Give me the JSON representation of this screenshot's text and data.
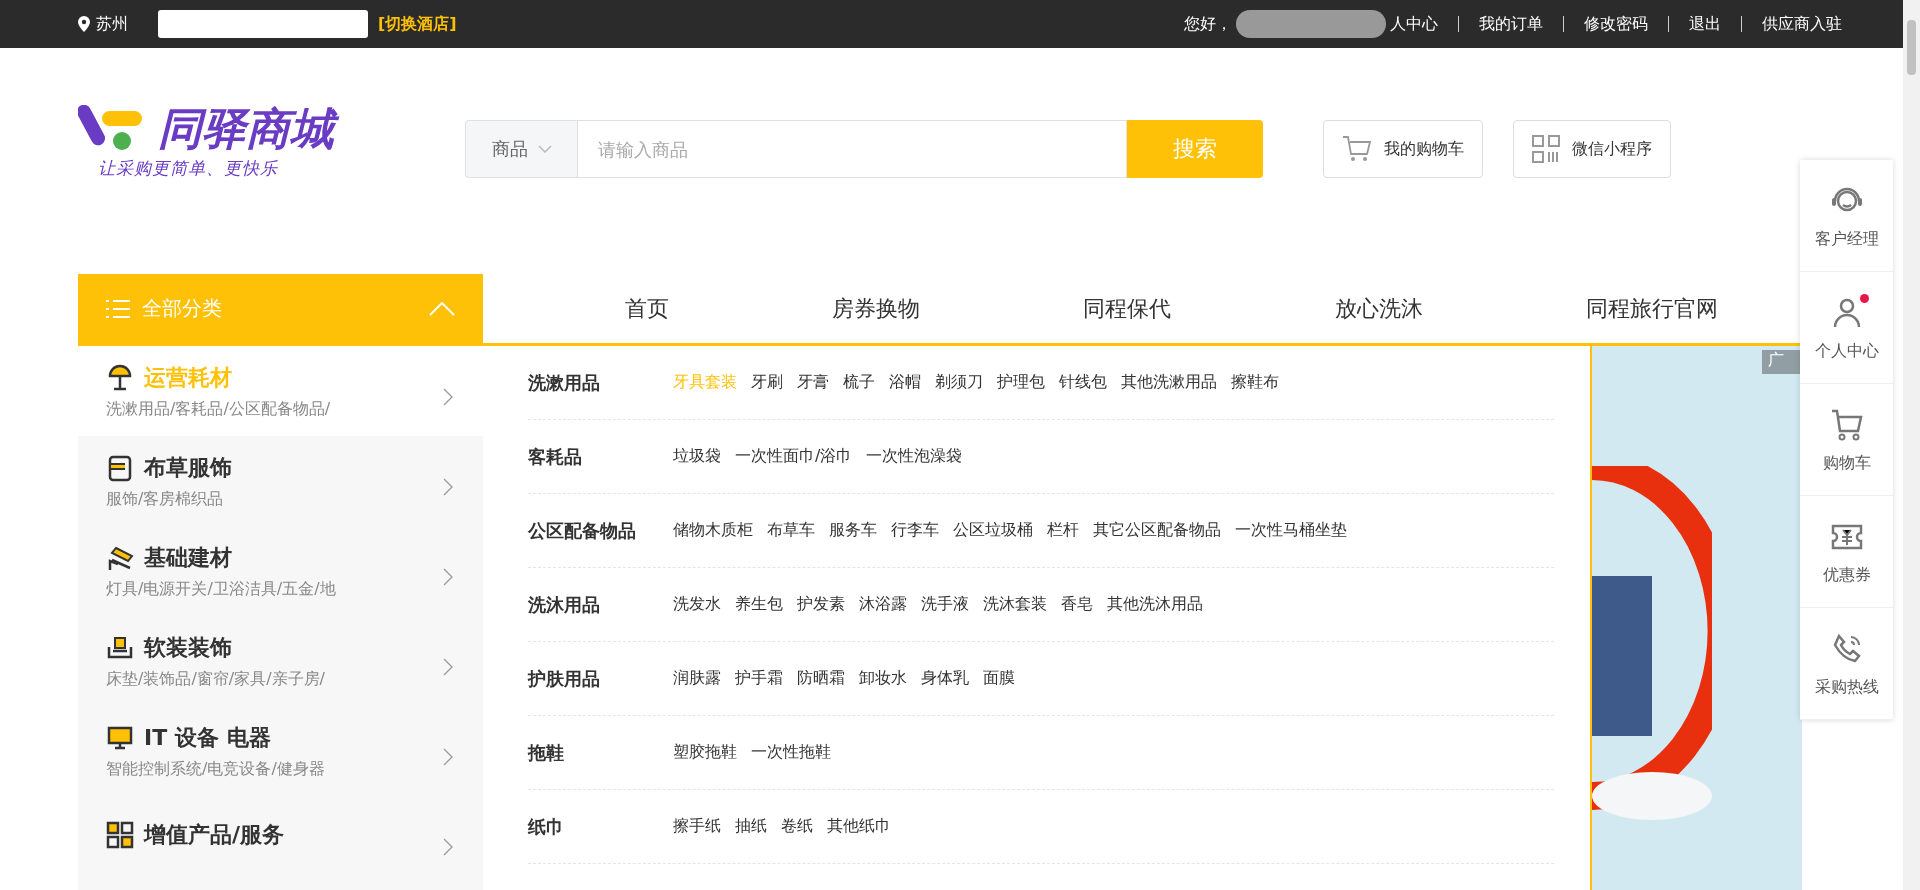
{
  "top_bar": {
    "city": "苏州",
    "switch_hotel": "[切换酒店]",
    "greeting": "您好，",
    "links": [
      "人中心",
      "我的订单",
      "修改密码",
      "退出",
      "供应商入驻"
    ]
  },
  "logo": {
    "name": "同驿商城",
    "slogan": "让采购更简单、更快乐"
  },
  "search": {
    "scope": "商品",
    "placeholder": "请输入商品",
    "button": "搜索"
  },
  "header_buttons": [
    "我的购物车",
    "微信小程序"
  ],
  "nav": {
    "all_categories": "全部分类",
    "expanded": true,
    "items": [
      "首页",
      "房券换物",
      "同程保代",
      "放心洗沐",
      "同程旅行官网"
    ]
  },
  "categories": [
    {
      "title": "运营耗材",
      "subtitle": "洗漱用品/客耗品/公区配备物品/",
      "selected": true
    },
    {
      "title": "布草服饰",
      "subtitle": "服饰/客房棉织品",
      "selected": false
    },
    {
      "title": "基础建材",
      "subtitle": "灯具/电源开关/卫浴洁具/五金/地",
      "selected": false
    },
    {
      "title": "软装装饰",
      "subtitle": "床垫/装饰品/窗帘/家具/亲子房/",
      "selected": false
    },
    {
      "title": "IT 设备 电器",
      "subtitle": "智能控制系统/电竞设备/健身器",
      "selected": false
    },
    {
      "title": "增值产品/服务",
      "selected": false
    }
  ],
  "subcategories": [
    {
      "label": "洗漱用品",
      "links": [
        {
          "label": "牙具套装",
          "selected": true
        },
        {
          "label": "牙刷",
          "selected": false
        },
        {
          "label": "牙膏",
          "selected": false
        },
        {
          "label": "梳子",
          "selected": false
        },
        {
          "label": "浴帽",
          "selected": false
        },
        {
          "label": "剃须刀",
          "selected": false
        },
        {
          "label": "护理包",
          "selected": false
        },
        {
          "label": "针线包",
          "selected": false
        },
        {
          "label": "其他洗漱用品",
          "selected": false
        },
        {
          "label": "擦鞋布",
          "selected": false
        }
      ]
    },
    {
      "label": "客耗品",
      "links": [
        {
          "label": "垃圾袋",
          "selected": false
        },
        {
          "label": "一次性面巾/浴巾",
          "selected": false
        },
        {
          "label": "一次性泡澡袋",
          "selected": false
        }
      ]
    },
    {
      "label": "公区配备物品",
      "links": [
        {
          "label": "储物木质柜",
          "selected": false
        },
        {
          "label": "布草车",
          "selected": false
        },
        {
          "label": "服务车",
          "selected": false
        },
        {
          "label": "行李车",
          "selected": false
        },
        {
          "label": "公区垃圾桶",
          "selected": false
        },
        {
          "label": "栏杆",
          "selected": false
        },
        {
          "label": "其它公区配备物品",
          "selected": false
        },
        {
          "label": "一次性马桶坐垫",
          "selected": false
        }
      ]
    },
    {
      "label": "洗沐用品",
      "links": [
        {
          "label": "洗发水",
          "selected": false
        },
        {
          "label": "养生包",
          "selected": false
        },
        {
          "label": "护发素",
          "selected": false
        },
        {
          "label": "沐浴露",
          "selected": false
        },
        {
          "label": "洗手液",
          "selected": false
        },
        {
          "label": "洗沐套装",
          "selected": false
        },
        {
          "label": "香皂",
          "selected": false
        },
        {
          "label": "其他洗沐用品",
          "selected": false
        }
      ]
    },
    {
      "label": "护肤用品",
      "links": [
        {
          "label": "润肤露",
          "selected": false
        },
        {
          "label": "护手霜",
          "selected": false
        },
        {
          "label": "防晒霜",
          "selected": false
        },
        {
          "label": "卸妆水",
          "selected": false
        },
        {
          "label": "身体乳",
          "selected": false
        },
        {
          "label": "面膜",
          "selected": false
        }
      ]
    },
    {
      "label": "拖鞋",
      "links": [
        {
          "label": "塑胶拖鞋",
          "selected": false
        },
        {
          "label": "一次性拖鞋",
          "selected": false
        }
      ]
    },
    {
      "label": "纸巾",
      "links": [
        {
          "label": "擦手纸",
          "selected": false
        },
        {
          "label": "抽纸",
          "selected": false
        },
        {
          "label": "卷纸",
          "selected": false
        },
        {
          "label": "其他纸巾",
          "selected": false
        }
      ]
    }
  ],
  "ad": {
    "tag": "广"
  },
  "side_panel": [
    {
      "label": "客户经理",
      "dot": false
    },
    {
      "label": "个人中心",
      "dot": true
    },
    {
      "label": "购物车",
      "dot": false
    },
    {
      "label": "优惠券",
      "dot": false
    },
    {
      "label": "采购热线",
      "dot": false
    }
  ]
}
